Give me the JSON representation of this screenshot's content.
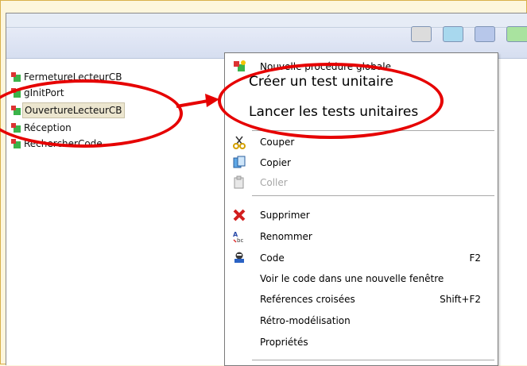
{
  "tree": {
    "items": [
      {
        "label": "FermetureLecteurCB",
        "selected": false
      },
      {
        "label": "gInitPort",
        "selected": false
      },
      {
        "label": "OuvertureLecteurCB",
        "selected": true
      },
      {
        "label": "Réception",
        "selected": false
      },
      {
        "label": "RechercherCode",
        "selected": false
      }
    ]
  },
  "menu": {
    "new_global": "Nouvelle procédure globale",
    "create_test": "Créer un test unitaire",
    "run_tests": "Lancer les tests unitaires",
    "cut": "Couper",
    "copy": "Copier",
    "paste": "Coller",
    "delete": "Supprimer",
    "rename": "Renommer",
    "code": "Code",
    "code_shortcut": "F2",
    "view_code_new_window": "Voir le code dans une nouvelle fenêtre",
    "cross_refs": "Reférences croisées",
    "cross_refs_shortcut": "Shift+F2",
    "retro_modeling": "Rétro-modélisation",
    "properties": "Propriétés"
  },
  "colors": {
    "annotation": "#e60000",
    "selection": "#ece6cf",
    "toolbar": "#d6def0"
  }
}
